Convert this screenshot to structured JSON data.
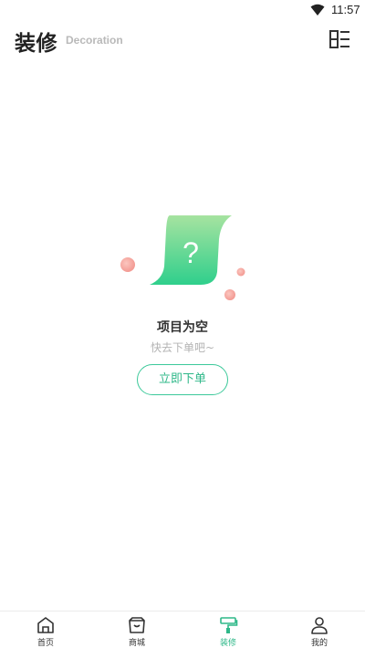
{
  "status_bar": {
    "time": "11:57"
  },
  "header": {
    "title": "装修",
    "subtitle": "Decoration"
  },
  "empty_state": {
    "title": "项目为空",
    "subtitle": "快去下单吧~",
    "button_label": "立即下单",
    "illustration_symbol": "?"
  },
  "bottom_nav": {
    "items": [
      {
        "label": "首页",
        "icon": "home-icon",
        "active": false
      },
      {
        "label": "商城",
        "icon": "shop-bag-icon",
        "active": false
      },
      {
        "label": "装修",
        "icon": "paint-roller-icon",
        "active": true
      },
      {
        "label": "我的",
        "icon": "user-icon",
        "active": false
      }
    ]
  },
  "colors": {
    "accent": "#2fb889",
    "accent_light": "#7ddfa9",
    "ball": "#f6a3a0"
  }
}
